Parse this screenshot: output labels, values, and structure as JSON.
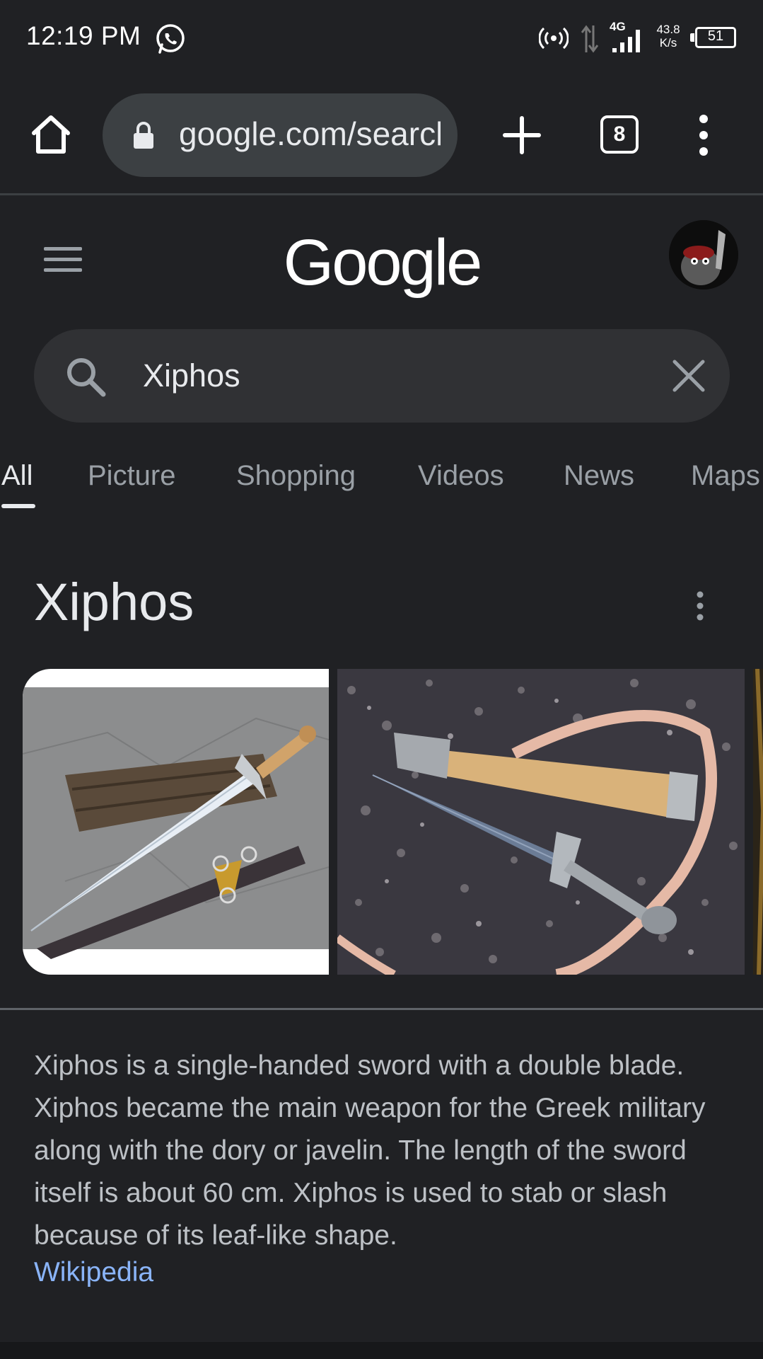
{
  "status_bar": {
    "time": "12:19 PM",
    "network_type": "4G",
    "net_speed_value": "43.8",
    "net_speed_unit": "K/s",
    "battery": "51",
    "icons": [
      "whatsapp-icon",
      "hotspot-icon",
      "data-arrows-icon",
      "signal-icon",
      "battery-icon"
    ]
  },
  "browser": {
    "url": "google.com/search",
    "tab_count": "8",
    "icons": [
      "home-icon",
      "lock-icon",
      "plus-icon",
      "tabs-icon",
      "more-vert-icon"
    ]
  },
  "google": {
    "logo": "Google"
  },
  "search": {
    "query": "Xiphos"
  },
  "tabs": [
    {
      "label": "All",
      "active": true
    },
    {
      "label": "Picture",
      "active": false
    },
    {
      "label": "Shopping",
      "active": false
    },
    {
      "label": "Videos",
      "active": false
    },
    {
      "label": "News",
      "active": false
    },
    {
      "label": "Maps",
      "active": false
    }
  ],
  "knowledge_panel": {
    "title": "Xiphos",
    "description": "Xiphos is a single-handed sword with a double blade. Xiphos became the main weapon for the Greek military along with the dory or javelin. The length of the sword itself is about 60 cm. Xiphos is used to stab or slash because of its leaf-like shape.",
    "source": "Wikipedia",
    "images": [
      "xiphos-sword-with-scabbard",
      "xiphos-sword-on-gravel"
    ]
  },
  "colors": {
    "background": "#202124",
    "search_box": "#303134",
    "link": "#8ab4f8",
    "text_primary": "#e8eaed",
    "text_secondary": "#9aa0a6"
  }
}
